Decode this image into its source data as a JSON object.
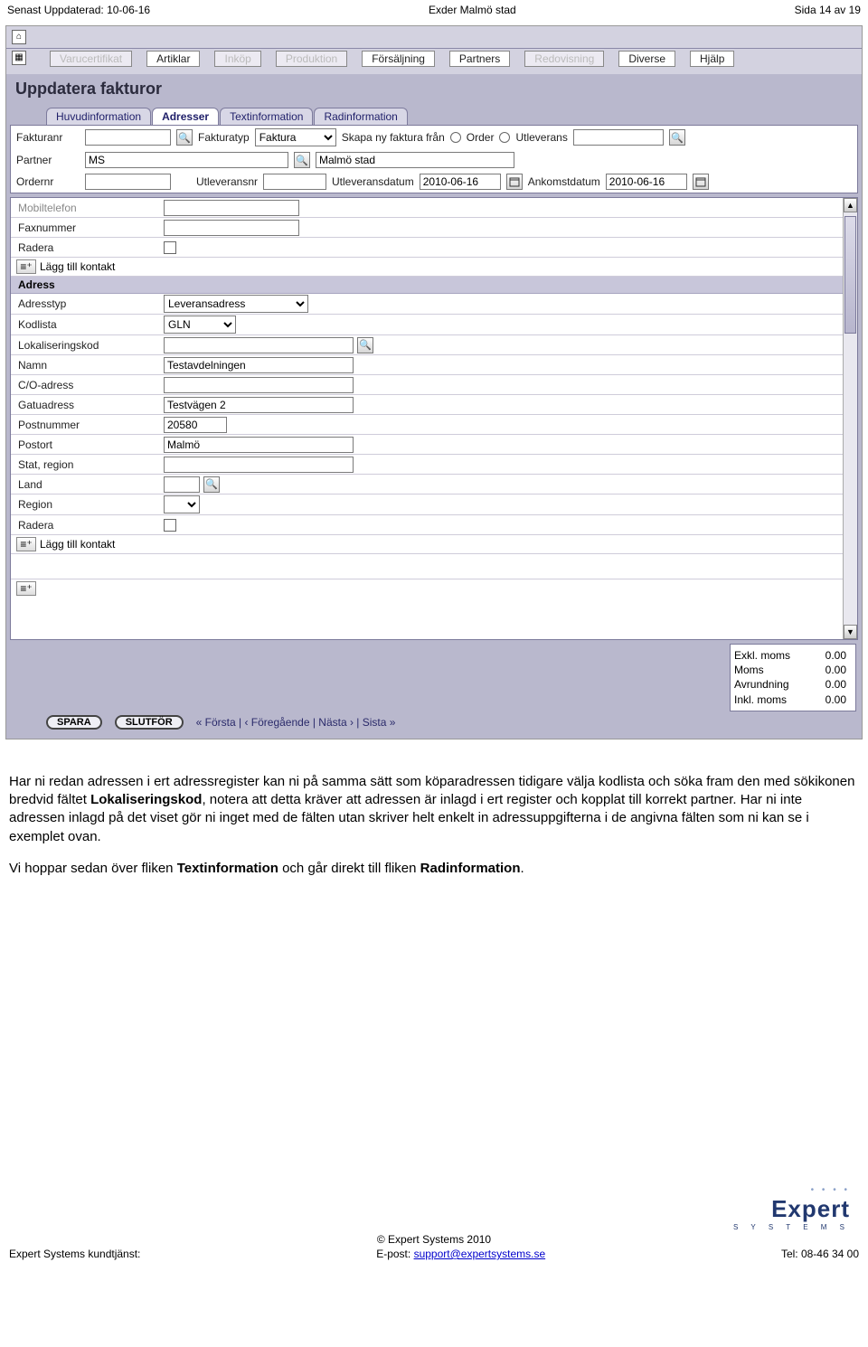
{
  "header": {
    "left": "Senast Uppdaterad: 10-06-16",
    "center": "Exder Malmö stad",
    "right": "Sida 14 av 19"
  },
  "topnav": [
    {
      "label": "Varucertifikat",
      "dim": true
    },
    {
      "label": "Artiklar",
      "dim": false
    },
    {
      "label": "Inköp",
      "dim": true
    },
    {
      "label": "Produktion",
      "dim": true
    },
    {
      "label": "Försäljning",
      "dim": false
    },
    {
      "label": "Partners",
      "dim": false
    },
    {
      "label": "Redovisning",
      "dim": true
    },
    {
      "label": "Diverse",
      "dim": false
    },
    {
      "label": "Hjälp",
      "dim": false
    }
  ],
  "section_title": "Uppdatera fakturor",
  "tabs": [
    {
      "label": "Huvudinformation",
      "active": false
    },
    {
      "label": "Adresser",
      "active": true
    },
    {
      "label": "Textinformation",
      "active": false
    },
    {
      "label": "Radinformation",
      "active": false
    }
  ],
  "filters": {
    "fakturanr_label": "Fakturanr",
    "fakturanr": "",
    "fakturatyp_label": "Fakturatyp",
    "fakturatyp": "Faktura",
    "skapa_label": "Skapa ny faktura från",
    "order_label": "Order",
    "utleverans_label": "Utleverans",
    "utleverans_val": "",
    "partner_label": "Partner",
    "partner": "MS",
    "partner_name": "Malmö stad",
    "ordernr_label": "Ordernr",
    "ordernr": "",
    "utleveransnr_label": "Utleveransnr",
    "utleveransnr": "",
    "utleveransdatum_label": "Utleveransdatum",
    "utleveransdatum": "2010-06-16",
    "ankomstdatum_label": "Ankomstdatum",
    "ankomstdatum": "2010-06-16"
  },
  "contact": {
    "mobiltelefon": "Mobiltelefon",
    "faxnummer": "Faxnummer",
    "radera": "Radera",
    "add": "Lägg till kontakt"
  },
  "adress": {
    "head": "Adress",
    "adresstyp_label": "Adresstyp",
    "adresstyp": "Leveransadress",
    "kodlista_label": "Kodlista",
    "kodlista": "GLN",
    "lokaliseringskod_label": "Lokaliseringskod",
    "lokaliseringskod": "",
    "namn_label": "Namn",
    "namn": "Testavdelningen",
    "co_label": "C/O-adress",
    "co": "",
    "gatuadress_label": "Gatuadress",
    "gatuadress": "Testvägen 2",
    "postnummer_label": "Postnummer",
    "postnummer": "20580",
    "postort_label": "Postort",
    "postort": "Malmö",
    "stat_label": "Stat, region",
    "stat": "",
    "land_label": "Land",
    "land": "",
    "region_label": "Region",
    "region": "",
    "radera_label": "Radera",
    "add": "Lägg till kontakt"
  },
  "footer": {
    "spara": "SPARA",
    "slutfor": "SLUTFÖR",
    "pager": "« Första  |  ‹ Föregående  |  Nästa ›  |  Sista »"
  },
  "totals": {
    "exkl": "Exkl. moms",
    "exkl_v": "0.00",
    "moms": "Moms",
    "moms_v": "0.00",
    "avr": "Avrundning",
    "avr_v": "0.00",
    "inkl": "Inkl. moms",
    "inkl_v": "0.00"
  },
  "body": {
    "p1a": "Har ni redan adressen i ert adressregister kan ni på samma sätt som köparadressen tidigare välja kodlista och söka fram den med sökikonen bredvid fältet ",
    "p1b": "Lokaliseringskod",
    "p1c": ", notera att detta kräver att adressen är inlagd i ert register och kopplat till korrekt partner. Har ni inte adressen inlagd på det viset gör ni inget med de fälten utan skriver helt enkelt in adressuppgifterna i de angivna fälten som ni kan se i exemplet ovan.",
    "p2a": "Vi hoppar sedan över fliken ",
    "p2b": "Textinformation",
    "p2c": " och går direkt till fliken ",
    "p2d": "Radinformation",
    "p2e": "."
  },
  "pagefooter": {
    "copyright": "© Expert Systems 2010",
    "left": "Expert Systems kundtjänst:",
    "mid_label": "E-post: ",
    "mid_link": "support@expertsystems.se",
    "right": "Tel: 08-46 34 00",
    "logo_main": "Expert",
    "logo_sub": "S Y S T E M S"
  }
}
